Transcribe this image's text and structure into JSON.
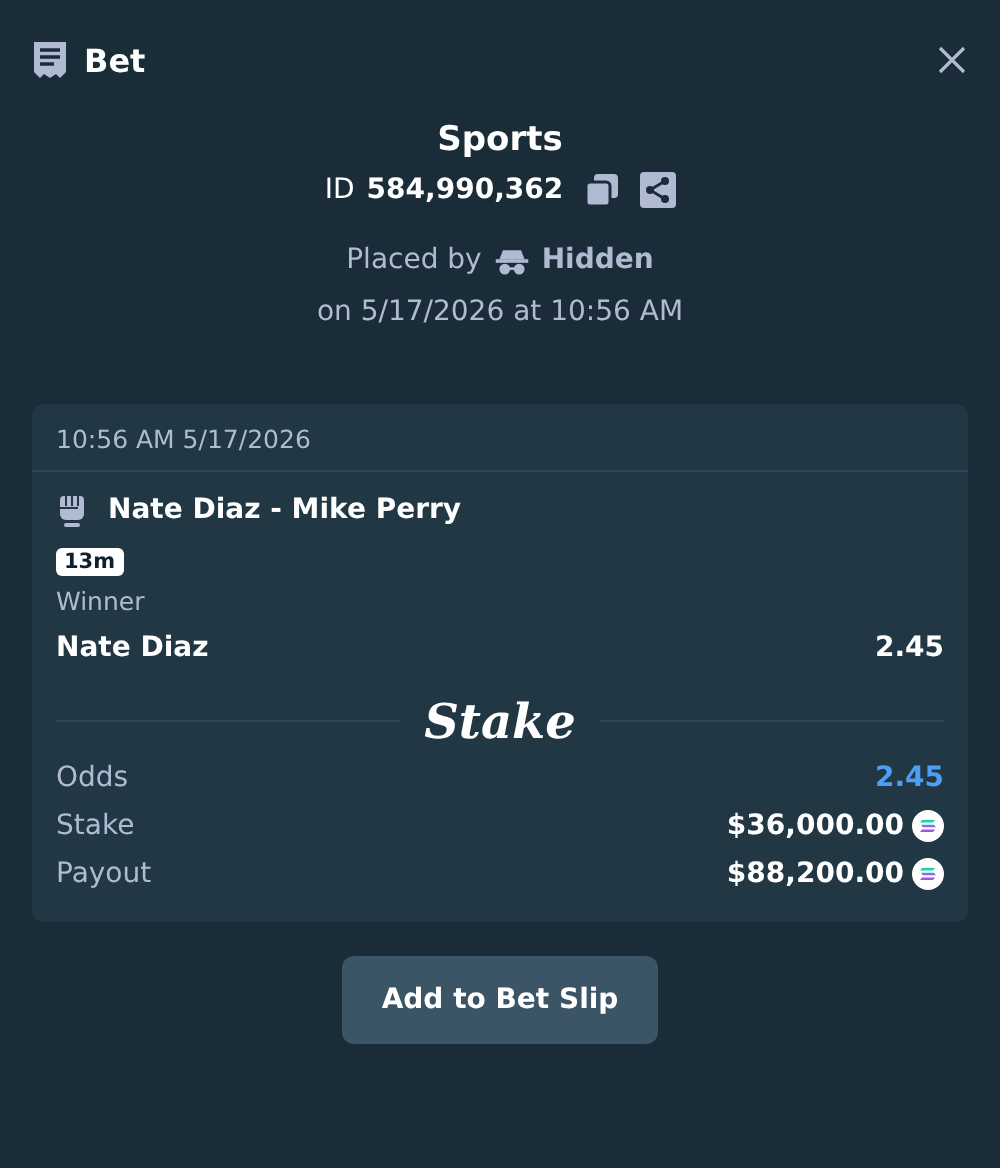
{
  "header": {
    "title": "Bet"
  },
  "bet": {
    "category": "Sports",
    "id_label": "ID",
    "id": "584,990,362",
    "placed_by_label": "Placed by",
    "user": "Hidden",
    "placed_on": "on 5/17/2026 at 10:56 AM"
  },
  "card": {
    "timestamp": "10:56 AM 5/17/2026",
    "event": "Nate Diaz - Mike Perry",
    "badge": "13m",
    "market": "Winner",
    "selection": "Nate Diaz",
    "selection_odds": "2.45",
    "brand": "Stake",
    "summary": [
      {
        "kind": "odds",
        "label": "Odds",
        "value": "2.45"
      },
      {
        "kind": "amount",
        "label": "Stake",
        "value": "$36,000.00"
      },
      {
        "kind": "amount",
        "label": "Payout",
        "value": "$88,200.00"
      }
    ]
  },
  "button": "Add to Bet Slip"
}
